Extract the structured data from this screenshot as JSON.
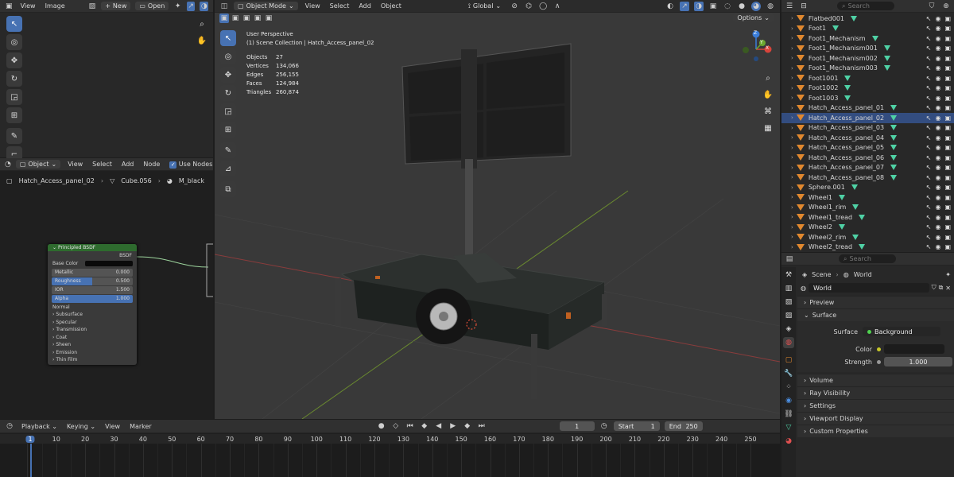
{
  "image_editor": {
    "menu_view": "View",
    "menu_image": "Image",
    "new_label": "New",
    "open_label": "Open"
  },
  "node_editor": {
    "object_mode": "Object",
    "menu_view": "View",
    "menu_select": "Select",
    "menu_add": "Add",
    "menu_node": "Node",
    "use_nodes_label": "Use Nodes",
    "breadcrumb_object": "Hatch_Access_panel_02",
    "breadcrumb_mesh": "Cube.056",
    "breadcrumb_material": "M_black",
    "node": {
      "title": "Principled BSDF",
      "output": "BSDF",
      "base_color": "Base Color",
      "metallic_label": "Metallic",
      "metallic_value": "0.000",
      "roughness_label": "Roughness",
      "roughness_value": "0.500",
      "ior_label": "IOR",
      "ior_value": "1.500",
      "alpha_label": "Alpha",
      "alpha_value": "1.000",
      "normal": "Normal",
      "panels": [
        "Subsurface",
        "Specular",
        "Transmission",
        "Coat",
        "Sheen",
        "Emission",
        "Thin Film"
      ]
    }
  },
  "viewport": {
    "mode": "Object Mode",
    "menu_view": "View",
    "menu_select": "Select",
    "menu_add": "Add",
    "menu_object": "Object",
    "transform_orientation": "Global",
    "options_label": "Options",
    "perspective": "User Perspective",
    "collection_info": "(1) Scene Collection | Hatch_Access_panel_02",
    "stats": [
      {
        "label": "Objects",
        "value": "27"
      },
      {
        "label": "Vertices",
        "value": "134,066"
      },
      {
        "label": "Edges",
        "value": "256,155"
      },
      {
        "label": "Faces",
        "value": "124,984"
      },
      {
        "label": "Triangles",
        "value": "260,874"
      }
    ],
    "gizmo": {
      "z": "Z",
      "y": "Y",
      "x": "X"
    }
  },
  "outliner": {
    "search_placeholder": "Search",
    "items": [
      {
        "name": "Flatbed001",
        "selected": false
      },
      {
        "name": "Foot1",
        "selected": false
      },
      {
        "name": "Foot1_Mechanism",
        "selected": false
      },
      {
        "name": "Foot1_Mechanism001",
        "selected": false
      },
      {
        "name": "Foot1_Mechanism002",
        "selected": false
      },
      {
        "name": "Foot1_Mechanism003",
        "selected": false
      },
      {
        "name": "Foot1001",
        "selected": false
      },
      {
        "name": "Foot1002",
        "selected": false
      },
      {
        "name": "Foot1003",
        "selected": false
      },
      {
        "name": "Hatch_Access_panel_01",
        "selected": false
      },
      {
        "name": "Hatch_Access_panel_02",
        "selected": true
      },
      {
        "name": "Hatch_Access_panel_03",
        "selected": false
      },
      {
        "name": "Hatch_Access_panel_04",
        "selected": false
      },
      {
        "name": "Hatch_Access_panel_05",
        "selected": false
      },
      {
        "name": "Hatch_Access_panel_06",
        "selected": false
      },
      {
        "name": "Hatch_Access_panel_07",
        "selected": false
      },
      {
        "name": "Hatch_Access_panel_08",
        "selected": false
      },
      {
        "name": "Sphere.001",
        "selected": false
      },
      {
        "name": "Wheel1",
        "selected": false
      },
      {
        "name": "Wheel1_rim",
        "selected": false
      },
      {
        "name": "Wheel1_tread",
        "selected": false
      },
      {
        "name": "Wheel2",
        "selected": false
      },
      {
        "name": "Wheel2_rim",
        "selected": false
      },
      {
        "name": "Wheel2_tread",
        "selected": false
      }
    ]
  },
  "properties": {
    "search_placeholder": "Search",
    "breadcrumb_scene": "Scene",
    "breadcrumb_world": "World",
    "world_name": "World",
    "sections": {
      "preview": "Preview",
      "surface": "Surface",
      "volume": "Volume",
      "ray_visibility": "Ray Visibility",
      "settings": "Settings",
      "viewport_display": "Viewport Display",
      "custom_properties": "Custom Properties"
    },
    "surface_label": "Surface",
    "surface_value": "Background",
    "color_label": "Color",
    "strength_label": "Strength",
    "strength_value": "1.000"
  },
  "timeline": {
    "menu_playback": "Playback",
    "menu_keying": "Keying",
    "menu_view": "View",
    "menu_marker": "Marker",
    "current_frame": "1",
    "start_label": "Start",
    "start_value": "1",
    "end_label": "End",
    "end_value": "250",
    "ticks": [
      "1",
      "10",
      "20",
      "30",
      "40",
      "50",
      "60",
      "70",
      "80",
      "90",
      "100",
      "110",
      "120",
      "130",
      "140",
      "150",
      "160",
      "170",
      "180",
      "190",
      "200",
      "210",
      "220",
      "230",
      "240",
      "250"
    ]
  },
  "colors": {
    "accent": "#4772b3",
    "node_header": "#2e6b2e",
    "object_icon": "#e0882f",
    "mesh_icon": "#4fd1a5"
  }
}
